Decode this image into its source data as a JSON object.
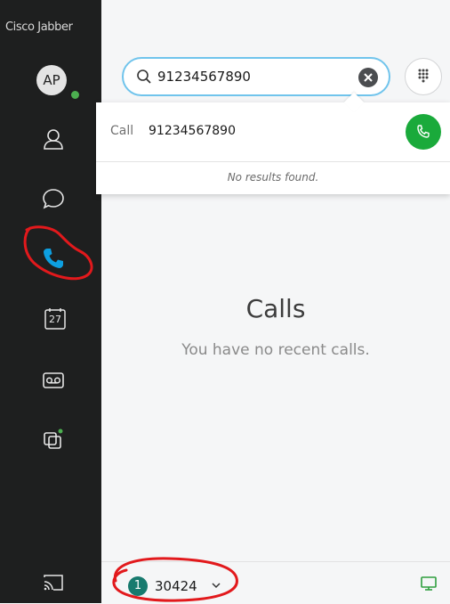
{
  "app": {
    "title": "Cisco Jabber"
  },
  "user": {
    "initials": "AP",
    "status_color": "#4caf50"
  },
  "sidebar": {
    "items": [
      {
        "name": "contacts",
        "icon": "person-icon"
      },
      {
        "name": "chats",
        "icon": "chat-bubble-icon"
      },
      {
        "name": "calls",
        "icon": "phone-icon",
        "active": true,
        "color": "#0d9fe0"
      },
      {
        "name": "meetings",
        "icon": "calendar-icon",
        "date_label": "27"
      },
      {
        "name": "voicemail",
        "icon": "voicemail-icon"
      },
      {
        "name": "multi-window",
        "icon": "window-icon"
      }
    ],
    "cast_icon": "cast-icon"
  },
  "search": {
    "value": "91234567890",
    "focus_color": "#70c4ec"
  },
  "dropdown": {
    "call_label": "Call",
    "call_number": "91234567890",
    "no_results": "No results found.",
    "call_button_color": "#1aaa3b"
  },
  "main": {
    "title": "Calls",
    "subtitle": "You have no recent calls."
  },
  "bottom_bar": {
    "badge_count": "1",
    "extension": "30424",
    "device_icon": "computer-icon"
  },
  "annotations": {
    "color": "#e2191c"
  }
}
